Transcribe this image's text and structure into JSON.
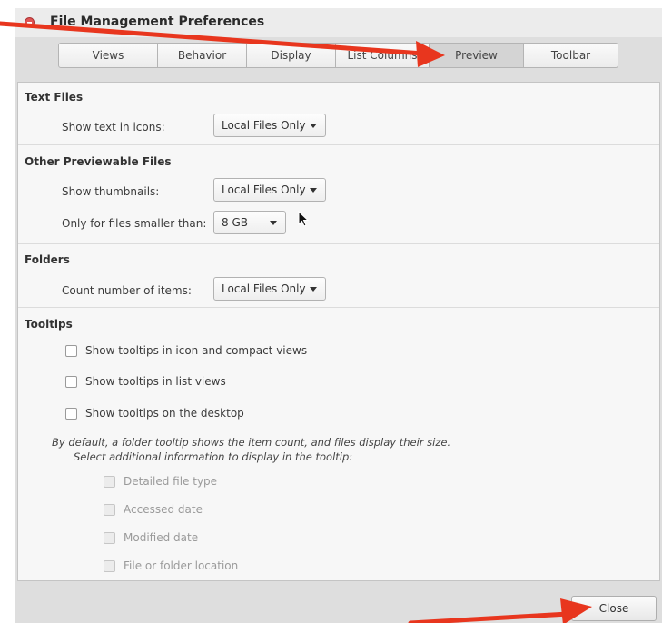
{
  "window": {
    "title": "File Management Preferences"
  },
  "tabs": [
    {
      "label": "Views"
    },
    {
      "label": "Behavior"
    },
    {
      "label": "Display"
    },
    {
      "label": "List Columns"
    },
    {
      "label": "Preview",
      "active": true
    },
    {
      "label": "Toolbar"
    }
  ],
  "text_files": {
    "heading": "Text Files",
    "show_text_label": "Show text in icons:",
    "show_text_value": "Local Files Only"
  },
  "other_files": {
    "heading": "Other Previewable Files",
    "thumbnails_label": "Show thumbnails:",
    "thumbnails_value": "Local Files Only",
    "size_label": "Only for files smaller than:",
    "size_value": "8 GB"
  },
  "folders": {
    "heading": "Folders",
    "count_label": "Count number of items:",
    "count_value": "Local Files Only"
  },
  "tooltips": {
    "heading": "Tooltips",
    "options": [
      {
        "label": "Show tooltips in icon and compact views",
        "checked": false
      },
      {
        "label": "Show tooltips in list views",
        "checked": false
      },
      {
        "label": "Show tooltips on the desktop",
        "checked": false
      }
    ],
    "info_line1": "By default, a folder tooltip shows the item count, and files display their size.",
    "info_line2": "Select additional information to display in the tooltip:",
    "extra_options": [
      {
        "label": "Detailed file type",
        "checked": false
      },
      {
        "label": "Accessed date",
        "checked": false
      },
      {
        "label": "Modified date",
        "checked": false
      },
      {
        "label": "File or folder location",
        "checked": false
      }
    ]
  },
  "footer": {
    "close_label": "Close"
  },
  "colors": {
    "annotation_arrow": "#e8361e",
    "window_close": "#e05555"
  }
}
